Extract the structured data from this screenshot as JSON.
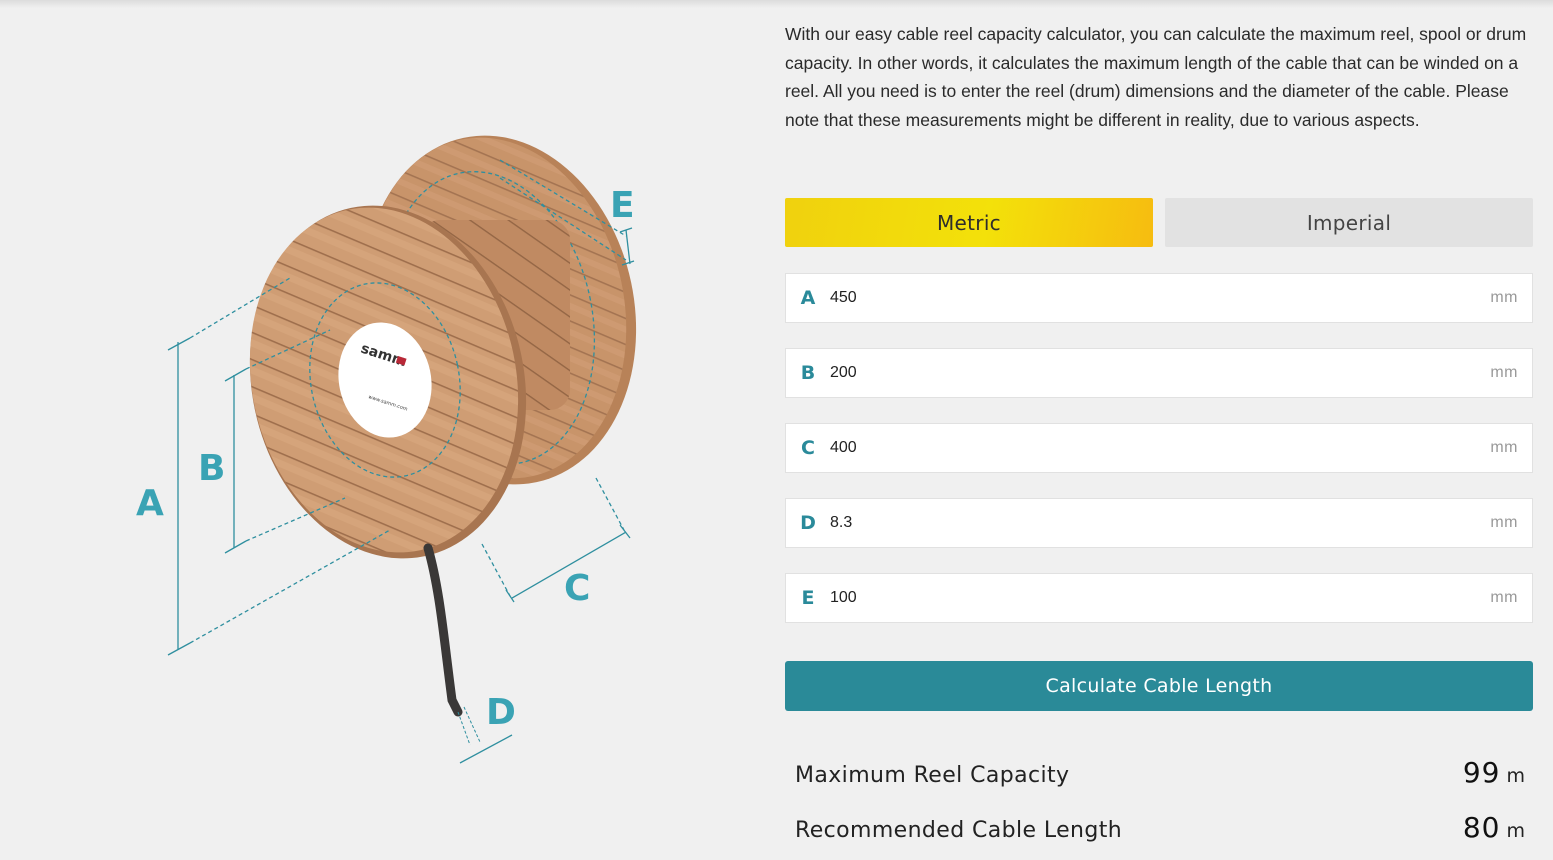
{
  "intro_text": "With our easy cable reel capacity calculator, you can calculate the maximum reel, spool or drum capacity. In other words, it calculates the maximum length of the cable that can be winded on a reel. All you need is to enter the reel (drum) dimensions and the diameter of the cable. Please note that these measurements might be different in reality, due to various aspects.",
  "diagram": {
    "labels": {
      "a": "A",
      "b": "B",
      "c": "C",
      "d": "D",
      "e": "E"
    },
    "label_color": "#3aa3b4",
    "logo_text": "samm",
    "logo_url_text": "www.samm.com"
  },
  "unit_toggle": {
    "metric_label": "Metric",
    "imperial_label": "Imperial",
    "selected": "Metric"
  },
  "fields": [
    {
      "letter": "A",
      "value": "450",
      "unit": "mm"
    },
    {
      "letter": "B",
      "value": "200",
      "unit": "mm"
    },
    {
      "letter": "C",
      "value": "400",
      "unit": "mm"
    },
    {
      "letter": "D",
      "value": "8.3",
      "unit": "mm"
    },
    {
      "letter": "E",
      "value": "100",
      "unit": "mm"
    }
  ],
  "calculate_label": "Calculate Cable Length",
  "results": {
    "max_label": "Maximum Reel Capacity",
    "max_value": "99",
    "max_unit": "m",
    "rec_label": "Recommended Cable Length",
    "rec_value": "80",
    "rec_unit": "m"
  },
  "colors": {
    "accent": "#2a8a98",
    "metric_gradient_start": "#f0d10e",
    "metric_gradient_end": "#f6bc10",
    "field_letter": "#2a8a9a"
  }
}
